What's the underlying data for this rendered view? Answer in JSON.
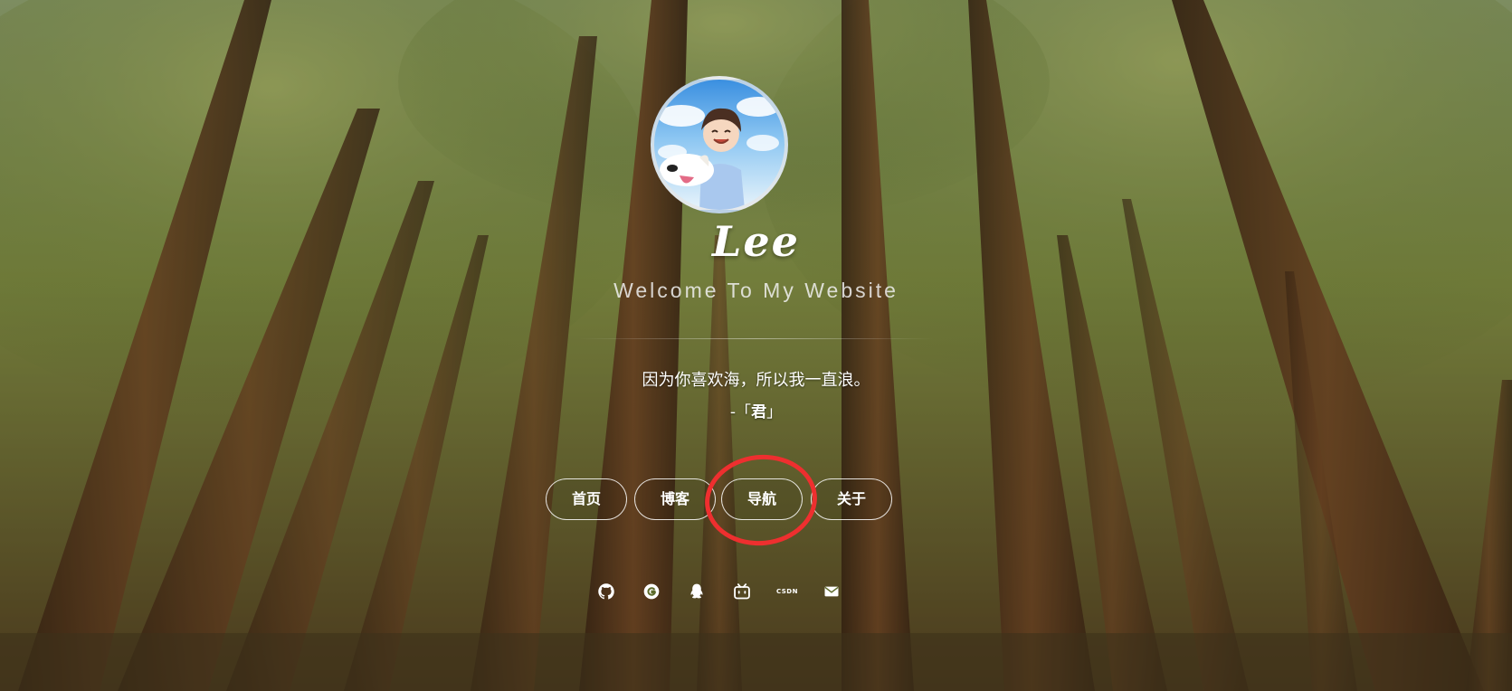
{
  "profile": {
    "name": "Lee",
    "tagline": "Welcome To My Website"
  },
  "quote": {
    "text": "因为你喜欢海，所以我一直浪。",
    "author_prefix": "-「",
    "author_name": "君",
    "author_suffix": "」"
  },
  "nav": {
    "home_label": "首页",
    "blog_label": "博客",
    "navigation_label": "导航",
    "about_label": "关于"
  },
  "social": {
    "github": "github-icon",
    "g": "g-icon",
    "qq": "qq-icon",
    "bilibili": "bilibili-icon",
    "csdn_label": "CSDN",
    "mail": "mail-icon"
  },
  "colors": {
    "highlight": "#ee2f2f",
    "text": "#ffffff"
  }
}
